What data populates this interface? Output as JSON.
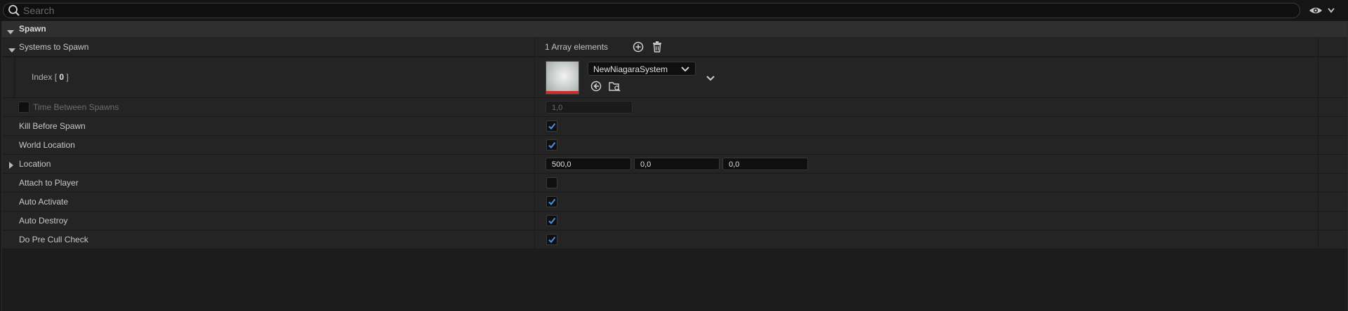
{
  "search": {
    "placeholder": "Search",
    "value": ""
  },
  "category": {
    "label": "Spawn"
  },
  "systems_to_spawn": {
    "label": "Systems to Spawn",
    "count_label": "1 Array elements",
    "index": {
      "prefix": "Index [ ",
      "number": "0",
      "suffix": " ]"
    },
    "asset": {
      "selected": "NewNiagaraSystem"
    }
  },
  "properties": {
    "time_between_spawns": {
      "label": "Time Between Spawns",
      "value": "1,0",
      "enabled": false
    },
    "kill_before_spawn": {
      "label": "Kill Before Spawn",
      "checked": true
    },
    "world_location": {
      "label": "World Location",
      "checked": true
    },
    "location": {
      "label": "Location",
      "x": "500,0",
      "y": "0,0",
      "z": "0,0"
    },
    "attach_to_player": {
      "label": "Attach to Player",
      "checked": false
    },
    "auto_activate": {
      "label": "Auto Activate",
      "checked": true
    },
    "auto_destroy": {
      "label": "Auto Destroy",
      "checked": true
    },
    "do_pre_cull_check": {
      "label": "Do Pre Cull Check",
      "checked": true
    }
  },
  "icons": {
    "search": "search-icon",
    "eye": "eye-icon",
    "add": "add-element-icon",
    "delete": "trash-icon",
    "browse": "browse-to-asset-icon",
    "use_selected": "use-selected-asset-icon"
  },
  "colors": {
    "accent": "#3d8bfd",
    "checkmark": "#4a90e2",
    "thumb_bar": "#d02a2a"
  }
}
